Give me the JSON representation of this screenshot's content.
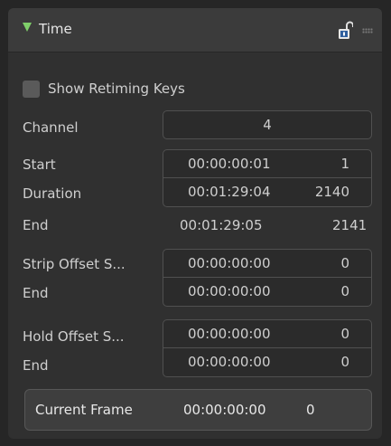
{
  "panel": {
    "title": "Time",
    "collapse_icon": "triangle-down-icon",
    "lock_icon": "unlocked-padlock-icon",
    "grip_icon": "drag-grip-icon"
  },
  "show_retiming_keys": {
    "label": "Show Retiming Keys",
    "checked": false
  },
  "channel": {
    "label": "Channel",
    "value": "4"
  },
  "start": {
    "label": "Start",
    "timecode": "00:00:00:01",
    "frame": "1"
  },
  "duration": {
    "label": "Duration",
    "timecode": "00:01:29:04",
    "frame": "2140"
  },
  "end": {
    "label": "End",
    "timecode": "00:01:29:05",
    "frame": "2141"
  },
  "strip_offset_start": {
    "label": "Strip Offset S...",
    "timecode": "00:00:00:00",
    "frame": "0"
  },
  "strip_offset_end": {
    "label": "End",
    "timecode": "00:00:00:00",
    "frame": "0"
  },
  "hold_offset_start": {
    "label": "Hold Offset S...",
    "timecode": "00:00:00:00",
    "frame": "0"
  },
  "hold_offset_end": {
    "label": "End",
    "timecode": "00:00:00:00",
    "frame": "0"
  },
  "current_frame": {
    "label": "Current Frame",
    "timecode": "00:00:00:00",
    "frame": "0"
  },
  "colors": {
    "accent": "#7fcf6a",
    "panel_bg": "#303030",
    "header_bg": "#3b3b3b",
    "field_bg": "#2b2b2b"
  }
}
